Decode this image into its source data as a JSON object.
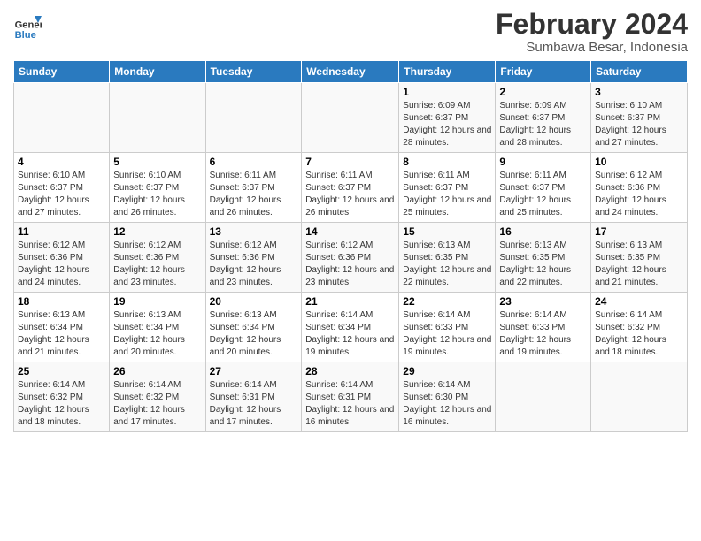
{
  "header": {
    "title": "February 2024",
    "subtitle": "Sumbawa Besar, Indonesia",
    "logo_line1": "General",
    "logo_line2": "Blue"
  },
  "days_of_week": [
    "Sunday",
    "Monday",
    "Tuesday",
    "Wednesday",
    "Thursday",
    "Friday",
    "Saturday"
  ],
  "weeks": [
    [
      {
        "day": "",
        "info": ""
      },
      {
        "day": "",
        "info": ""
      },
      {
        "day": "",
        "info": ""
      },
      {
        "day": "",
        "info": ""
      },
      {
        "day": "1",
        "info": "Sunrise: 6:09 AM\nSunset: 6:37 PM\nDaylight: 12 hours\nand 28 minutes."
      },
      {
        "day": "2",
        "info": "Sunrise: 6:09 AM\nSunset: 6:37 PM\nDaylight: 12 hours\nand 28 minutes."
      },
      {
        "day": "3",
        "info": "Sunrise: 6:10 AM\nSunset: 6:37 PM\nDaylight: 12 hours\nand 27 minutes."
      }
    ],
    [
      {
        "day": "4",
        "info": "Sunrise: 6:10 AM\nSunset: 6:37 PM\nDaylight: 12 hours\nand 27 minutes."
      },
      {
        "day": "5",
        "info": "Sunrise: 6:10 AM\nSunset: 6:37 PM\nDaylight: 12 hours\nand 26 minutes."
      },
      {
        "day": "6",
        "info": "Sunrise: 6:11 AM\nSunset: 6:37 PM\nDaylight: 12 hours\nand 26 minutes."
      },
      {
        "day": "7",
        "info": "Sunrise: 6:11 AM\nSunset: 6:37 PM\nDaylight: 12 hours\nand 26 minutes."
      },
      {
        "day": "8",
        "info": "Sunrise: 6:11 AM\nSunset: 6:37 PM\nDaylight: 12 hours\nand 25 minutes."
      },
      {
        "day": "9",
        "info": "Sunrise: 6:11 AM\nSunset: 6:37 PM\nDaylight: 12 hours\nand 25 minutes."
      },
      {
        "day": "10",
        "info": "Sunrise: 6:12 AM\nSunset: 6:36 PM\nDaylight: 12 hours\nand 24 minutes."
      }
    ],
    [
      {
        "day": "11",
        "info": "Sunrise: 6:12 AM\nSunset: 6:36 PM\nDaylight: 12 hours\nand 24 minutes."
      },
      {
        "day": "12",
        "info": "Sunrise: 6:12 AM\nSunset: 6:36 PM\nDaylight: 12 hours\nand 23 minutes."
      },
      {
        "day": "13",
        "info": "Sunrise: 6:12 AM\nSunset: 6:36 PM\nDaylight: 12 hours\nand 23 minutes."
      },
      {
        "day": "14",
        "info": "Sunrise: 6:12 AM\nSunset: 6:36 PM\nDaylight: 12 hours\nand 23 minutes."
      },
      {
        "day": "15",
        "info": "Sunrise: 6:13 AM\nSunset: 6:35 PM\nDaylight: 12 hours\nand 22 minutes."
      },
      {
        "day": "16",
        "info": "Sunrise: 6:13 AM\nSunset: 6:35 PM\nDaylight: 12 hours\nand 22 minutes."
      },
      {
        "day": "17",
        "info": "Sunrise: 6:13 AM\nSunset: 6:35 PM\nDaylight: 12 hours\nand 21 minutes."
      }
    ],
    [
      {
        "day": "18",
        "info": "Sunrise: 6:13 AM\nSunset: 6:34 PM\nDaylight: 12 hours\nand 21 minutes."
      },
      {
        "day": "19",
        "info": "Sunrise: 6:13 AM\nSunset: 6:34 PM\nDaylight: 12 hours\nand 20 minutes."
      },
      {
        "day": "20",
        "info": "Sunrise: 6:13 AM\nSunset: 6:34 PM\nDaylight: 12 hours\nand 20 minutes."
      },
      {
        "day": "21",
        "info": "Sunrise: 6:14 AM\nSunset: 6:34 PM\nDaylight: 12 hours\nand 19 minutes."
      },
      {
        "day": "22",
        "info": "Sunrise: 6:14 AM\nSunset: 6:33 PM\nDaylight: 12 hours\nand 19 minutes."
      },
      {
        "day": "23",
        "info": "Sunrise: 6:14 AM\nSunset: 6:33 PM\nDaylight: 12 hours\nand 19 minutes."
      },
      {
        "day": "24",
        "info": "Sunrise: 6:14 AM\nSunset: 6:32 PM\nDaylight: 12 hours\nand 18 minutes."
      }
    ],
    [
      {
        "day": "25",
        "info": "Sunrise: 6:14 AM\nSunset: 6:32 PM\nDaylight: 12 hours\nand 18 minutes."
      },
      {
        "day": "26",
        "info": "Sunrise: 6:14 AM\nSunset: 6:32 PM\nDaylight: 12 hours\nand 17 minutes."
      },
      {
        "day": "27",
        "info": "Sunrise: 6:14 AM\nSunset: 6:31 PM\nDaylight: 12 hours\nand 17 minutes."
      },
      {
        "day": "28",
        "info": "Sunrise: 6:14 AM\nSunset: 6:31 PM\nDaylight: 12 hours\nand 16 minutes."
      },
      {
        "day": "29",
        "info": "Sunrise: 6:14 AM\nSunset: 6:30 PM\nDaylight: 12 hours\nand 16 minutes."
      },
      {
        "day": "",
        "info": ""
      },
      {
        "day": "",
        "info": ""
      }
    ]
  ]
}
